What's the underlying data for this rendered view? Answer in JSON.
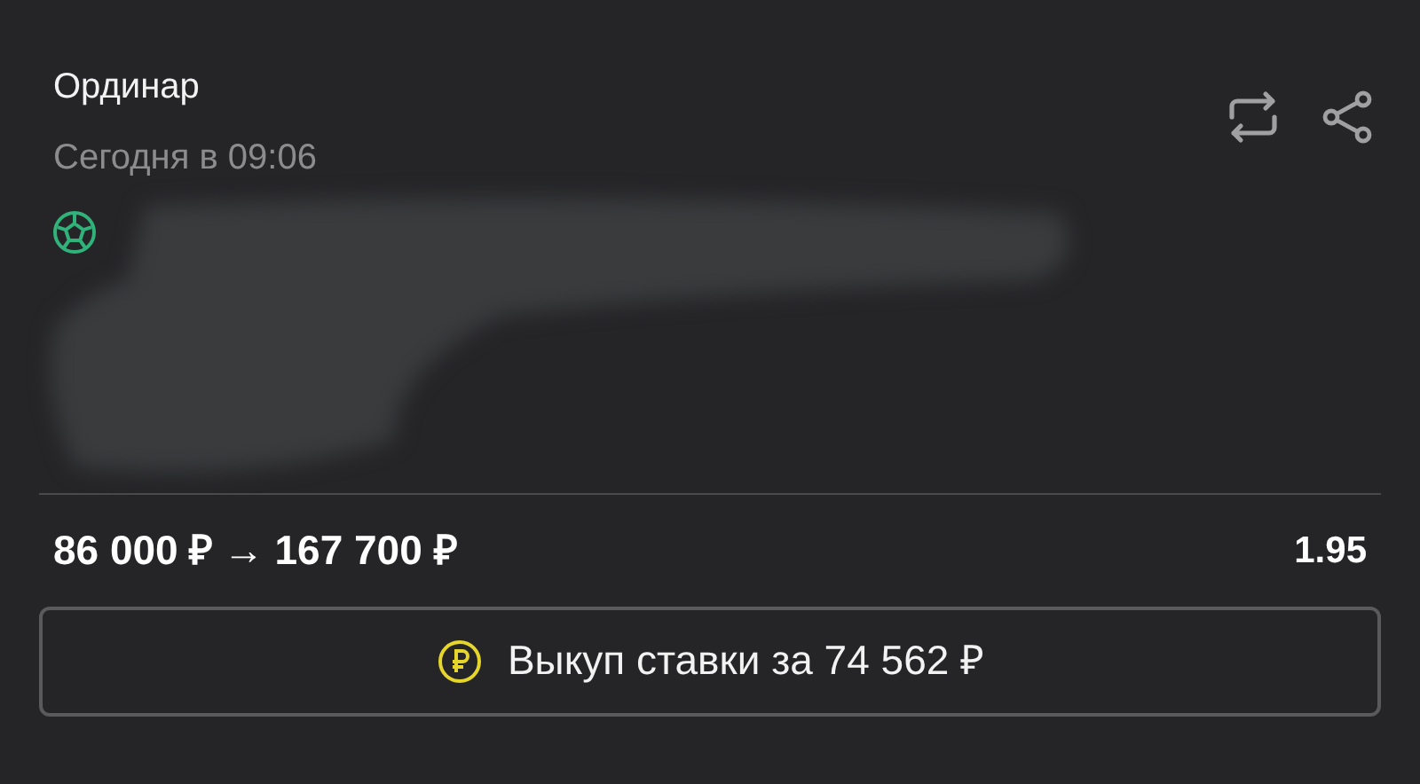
{
  "bet": {
    "type": "Ординар",
    "time": "Сегодня в 09:06"
  },
  "summary": {
    "stake": "86 000 ₽",
    "arrow": "→",
    "payout": "167 700 ₽",
    "odds": "1.95"
  },
  "cashout_button": {
    "label": "Выкуп ставки за 74 562 ₽"
  }
}
